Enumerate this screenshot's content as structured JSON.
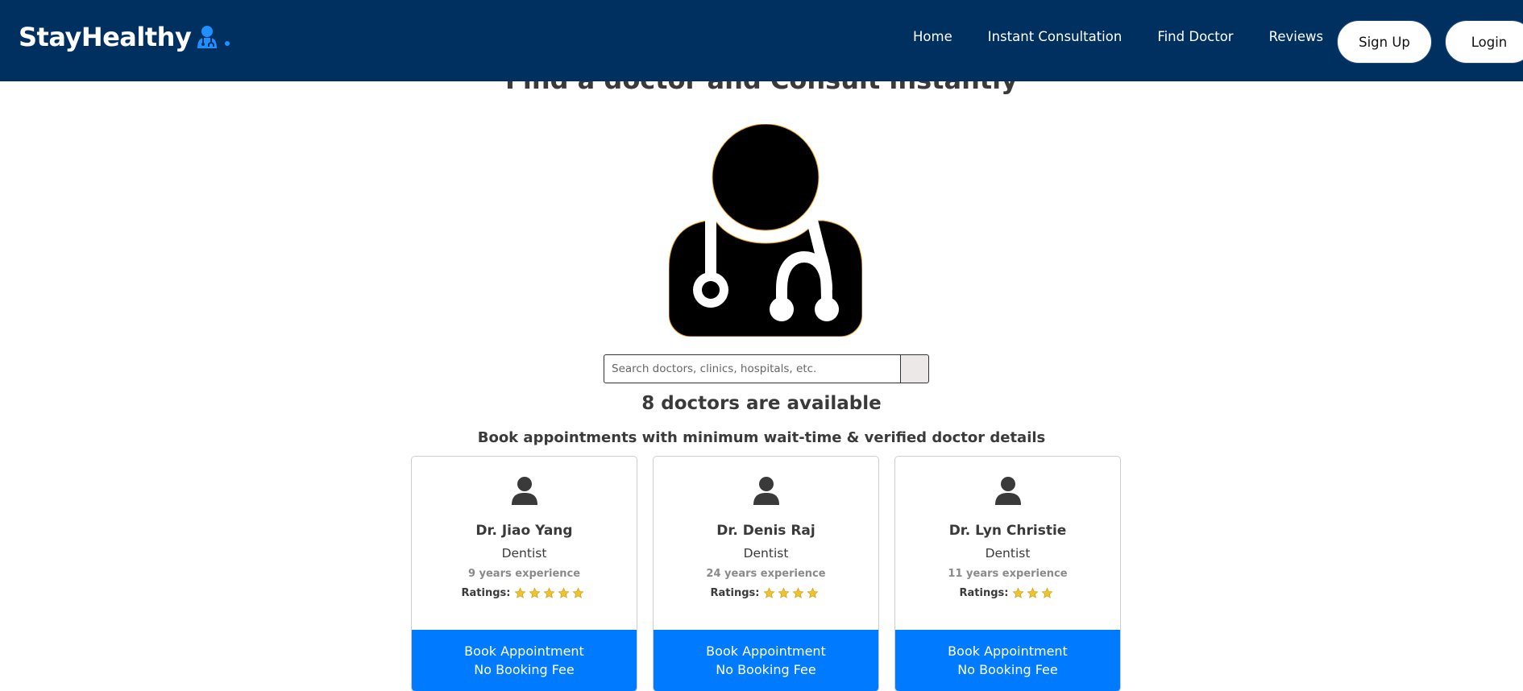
{
  "brand": {
    "name": "StayHealthy",
    "accent": "#1e90ff",
    "icon": "doctor-icon"
  },
  "nav": {
    "links": [
      "Home",
      "Instant Consultation",
      "Find Doctor",
      "Reviews"
    ],
    "signup_label": "Sign Up",
    "login_label": "Login",
    "bg_color": "#003060"
  },
  "hero": {
    "title": "Find a doctor and Consult instantly",
    "illustration": "doctor-stethoscope-icon"
  },
  "search": {
    "placeholder": "Search doctors, clinics, hospitals, etc.",
    "button_icon": "search-icon"
  },
  "results": {
    "available_text": "8 doctors are available",
    "subtitle": "Book appointments with minimum wait-time & verified doctor details"
  },
  "doctors": [
    {
      "name": "Dr. Jiao Yang",
      "specialty": "Dentist",
      "experience": "9 years experience",
      "ratings_label": "Ratings:",
      "stars": 5,
      "book_label": "Book Appointment",
      "fee_label": "No Booking Fee"
    },
    {
      "name": "Dr. Denis Raj",
      "specialty": "Dentist",
      "experience": "24 years experience",
      "ratings_label": "Ratings:",
      "stars": 4,
      "book_label": "Book Appointment",
      "fee_label": "No Booking Fee"
    },
    {
      "name": "Dr. Lyn Christie",
      "specialty": "Dentist",
      "experience": "11 years experience",
      "ratings_label": "Ratings:",
      "stars": 3,
      "book_label": "Book Appointment",
      "fee_label": "No Booking Fee"
    }
  ],
  "colors": {
    "primary_button": "#007bff",
    "star": "#f2c12e"
  }
}
